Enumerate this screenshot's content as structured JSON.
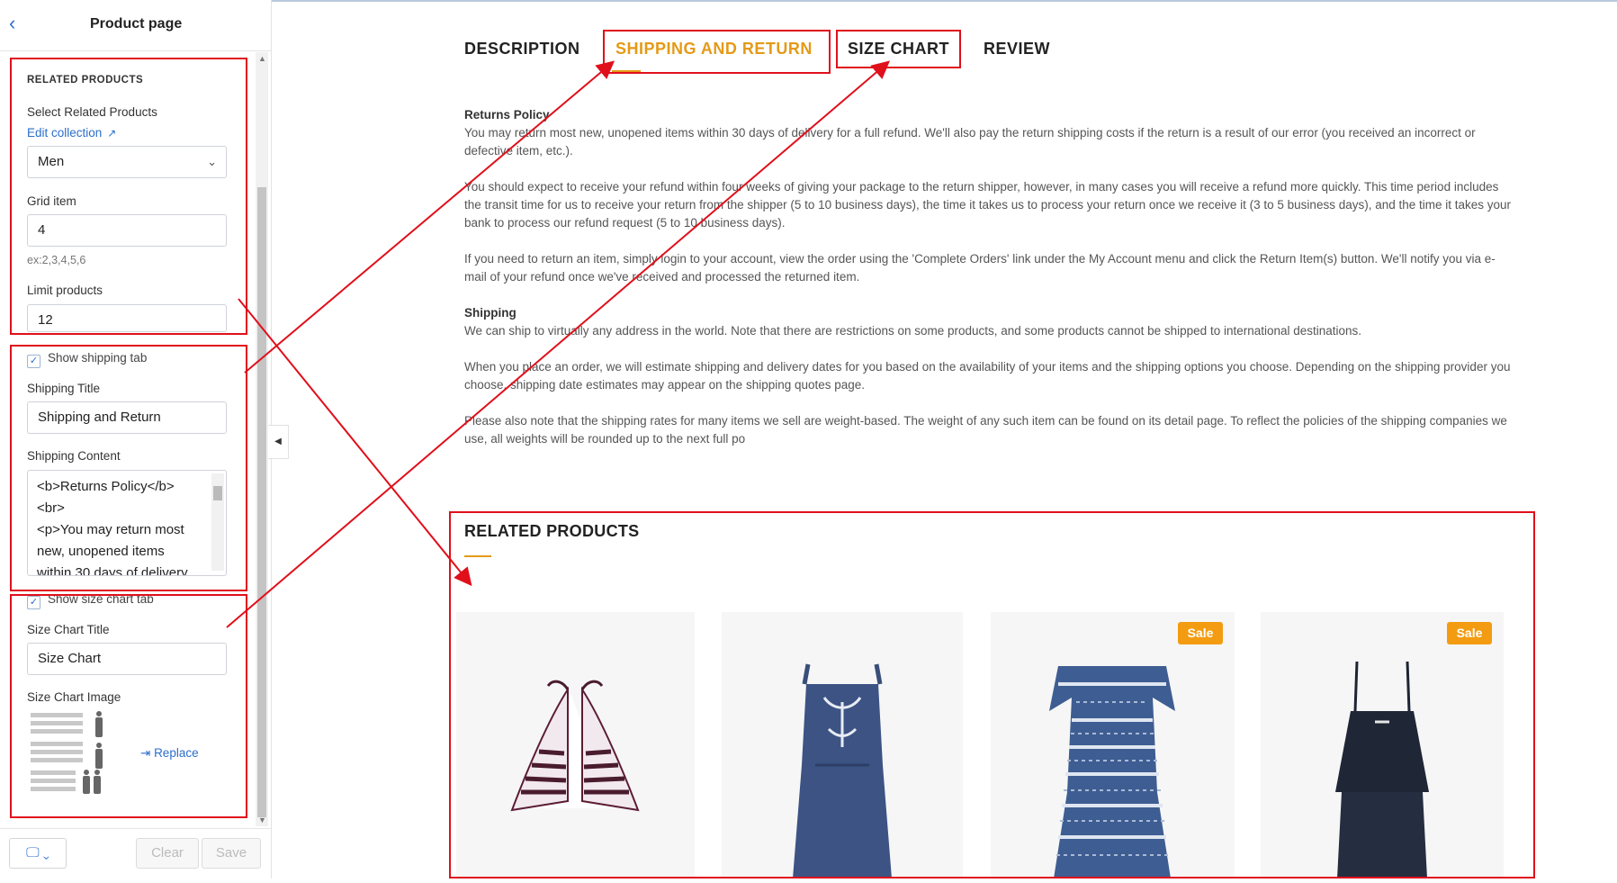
{
  "sidebar": {
    "title": "Product page",
    "related": {
      "heading": "RELATED PRODUCTS",
      "select_label": "Select Related Products",
      "edit_link": "Edit collection",
      "collection_value": "Men",
      "grid_label": "Grid item",
      "grid_value": "4",
      "grid_hint": "ex:2,3,4,5,6",
      "limit_label": "Limit products",
      "limit_value": "12"
    },
    "shipping": {
      "show_label": "Show shipping tab",
      "title_label": "Shipping Title",
      "title_value": "Shipping and Return",
      "content_label": "Shipping Content",
      "content_value": "<b>Returns Policy</b>\n<br>\n<p>You may return most\nnew, unopened items\nwithin 30 days of delivery"
    },
    "size_chart": {
      "show_label": "Show size chart tab",
      "title_label": "Size Chart Title",
      "title_value": "Size Chart",
      "image_label": "Size Chart Image",
      "replace_label": "Replace"
    },
    "footer": {
      "clear_label": "Clear",
      "save_label": "Save"
    }
  },
  "tabs": {
    "description": "DESCRIPTION",
    "shipping": "SHIPPING AND RETURN",
    "size_chart": "SIZE CHART",
    "review": "REVIEW"
  },
  "content": {
    "returns_heading": "Returns Policy",
    "returns_p1": "You may return most new, unopened items within 30 days of delivery for a full refund. We'll also pay the return shipping costs if the return is a result of our error (you received an incorrect or defective item, etc.).",
    "returns_p2": "You should expect to receive your refund within four weeks of giving your package to the return shipper, however, in many cases you will receive a refund more quickly. This time period includes the transit time for us to receive your return from the shipper (5 to 10 business days), the time it takes us to process your return once we receive it (3 to 5 business days), and the time it takes your bank to process our refund request (5 to 10 business days).",
    "returns_p3": "If you need to return an item, simply login to your account, view the order using the 'Complete Orders' link under the My Account menu and click the Return Item(s) button. We'll notify you via e-mail of your refund once we've received and processed the returned item.",
    "shipping_heading": "Shipping",
    "shipping_p1": "We can ship to virtually any address in the world. Note that there are restrictions on some products, and some products cannot be shipped to international destinations.",
    "shipping_p2": "When you place an order, we will estimate shipping and delivery dates for you based on the availability of your items and the shipping options you choose. Depending on the shipping provider you choose, shipping date estimates may appear on the shipping quotes page.",
    "shipping_p3": "Please also note that the shipping rates for many items we sell are weight-based. The weight of any such item can be found on its detail page. To reflect the policies of the shipping companies we use, all weights will be rounded up to the next full po"
  },
  "related_products": {
    "title": "RELATED PRODUCTS",
    "sale_badge": "Sale",
    "products": [
      {
        "name": "bikini-top",
        "on_sale": false
      },
      {
        "name": "embroidered-playsuit",
        "on_sale": false
      },
      {
        "name": "printed-off-shoulder-dress",
        "on_sale": true
      },
      {
        "name": "navy-strappy-playsuit",
        "on_sale": true
      }
    ]
  },
  "colors": {
    "accent": "#e49a17",
    "link": "#2c6ecb",
    "annotation": "#e0101b",
    "sale_badge": "#f39c12"
  }
}
